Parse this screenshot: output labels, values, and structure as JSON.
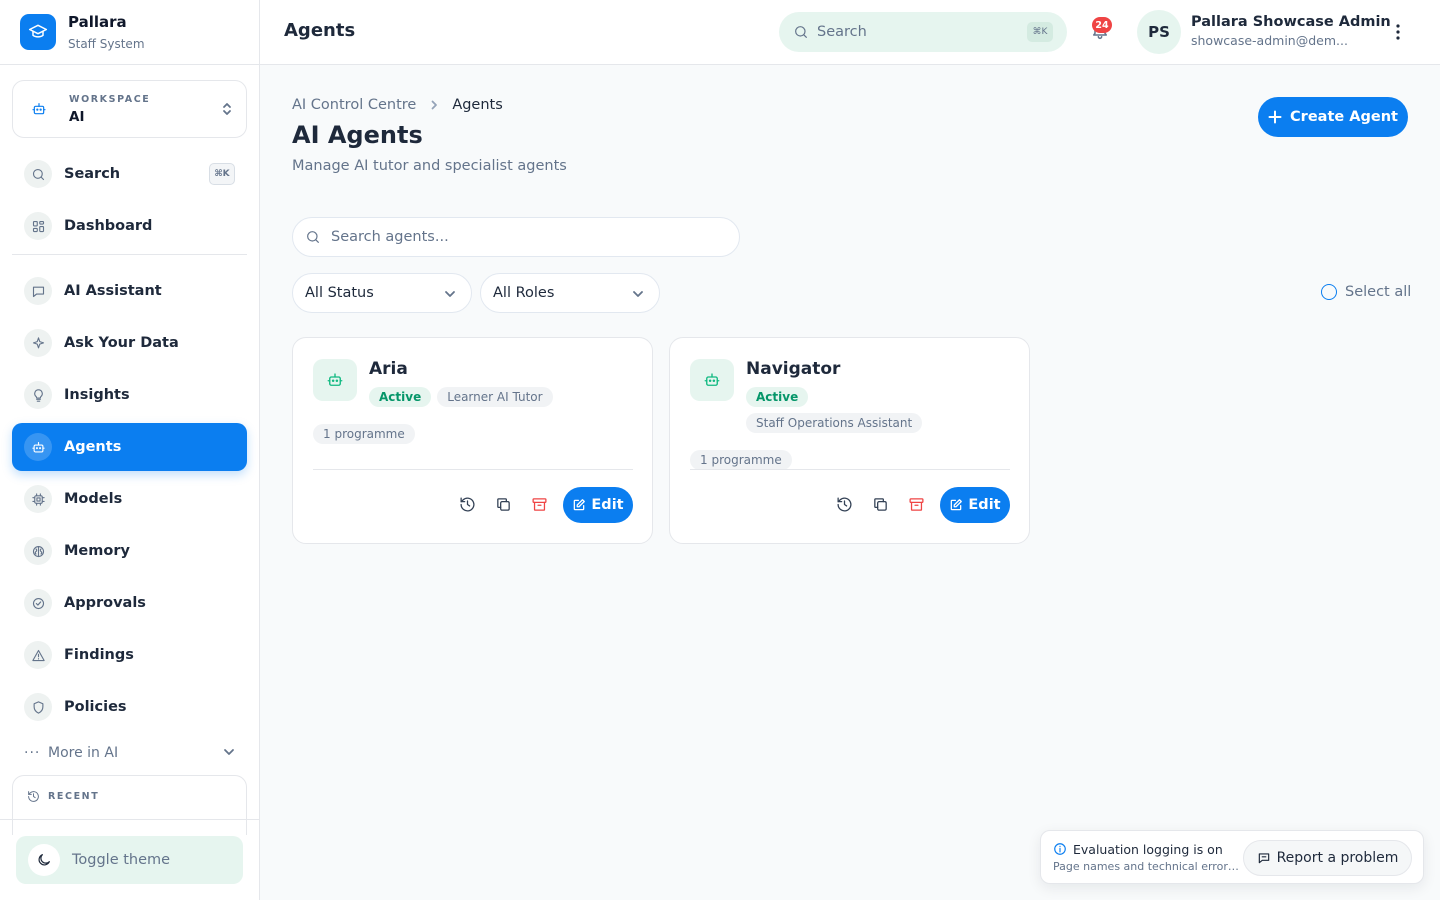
{
  "brand": {
    "name": "Pallara",
    "subtitle": "Staff System"
  },
  "workspace": {
    "label": "WORKSPACE",
    "value": "AI"
  },
  "sidebar": {
    "search": {
      "label": "Search",
      "shortcut": "⌘K",
      "icon": "search-icon"
    },
    "items": [
      {
        "label": "Dashboard",
        "icon": "grid-icon"
      },
      {
        "label": "AI Assistant",
        "icon": "chat-icon"
      },
      {
        "label": "Ask Your Data",
        "icon": "sparkle-icon"
      },
      {
        "label": "Insights",
        "icon": "lightbulb-icon"
      },
      {
        "label": "Agents",
        "icon": "robot-icon",
        "active": true
      },
      {
        "label": "Models",
        "icon": "chip-icon"
      },
      {
        "label": "Memory",
        "icon": "brain-icon"
      },
      {
        "label": "Approvals",
        "icon": "check-circle-icon"
      },
      {
        "label": "Findings",
        "icon": "warning-icon"
      },
      {
        "label": "Policies",
        "icon": "shield-icon"
      }
    ],
    "more": "More in AI",
    "recent": "RECENT",
    "toggle_theme": "Toggle theme"
  },
  "header": {
    "title": "Agents",
    "search_placeholder": "Search",
    "search_shortcut": "⌘K",
    "notification_count": "24",
    "user": {
      "initials": "PS",
      "name": "Pallara Showcase Admin",
      "email": "showcase-admin@dem..."
    }
  },
  "main": {
    "breadcrumb": [
      "AI Control Centre",
      "Agents"
    ],
    "title": "AI Agents",
    "subtitle": "Manage AI tutor and specialist agents",
    "create_button": "Create Agent",
    "search_placeholder": "Search agents...",
    "filters": {
      "status": "All Status",
      "roles": "All Roles"
    },
    "select_all": "Select all",
    "agents": [
      {
        "name": "Aria",
        "status": "Active",
        "role": "Learner AI Tutor",
        "programmes": "1 programme",
        "edit": "Edit"
      },
      {
        "name": "Navigator",
        "status": "Active",
        "role": "Staff Operations Assistant",
        "programmes": "1 programme",
        "edit": "Edit"
      }
    ]
  },
  "toast": {
    "title": "Evaluation logging is on",
    "text": "Page names and technical errors are recorded to improve the app.",
    "button": "Report a problem"
  },
  "colors": {
    "accent": "#0b7ef0",
    "mint": "#e6f5ef",
    "success": "#059669",
    "danger": "#ef4444"
  }
}
